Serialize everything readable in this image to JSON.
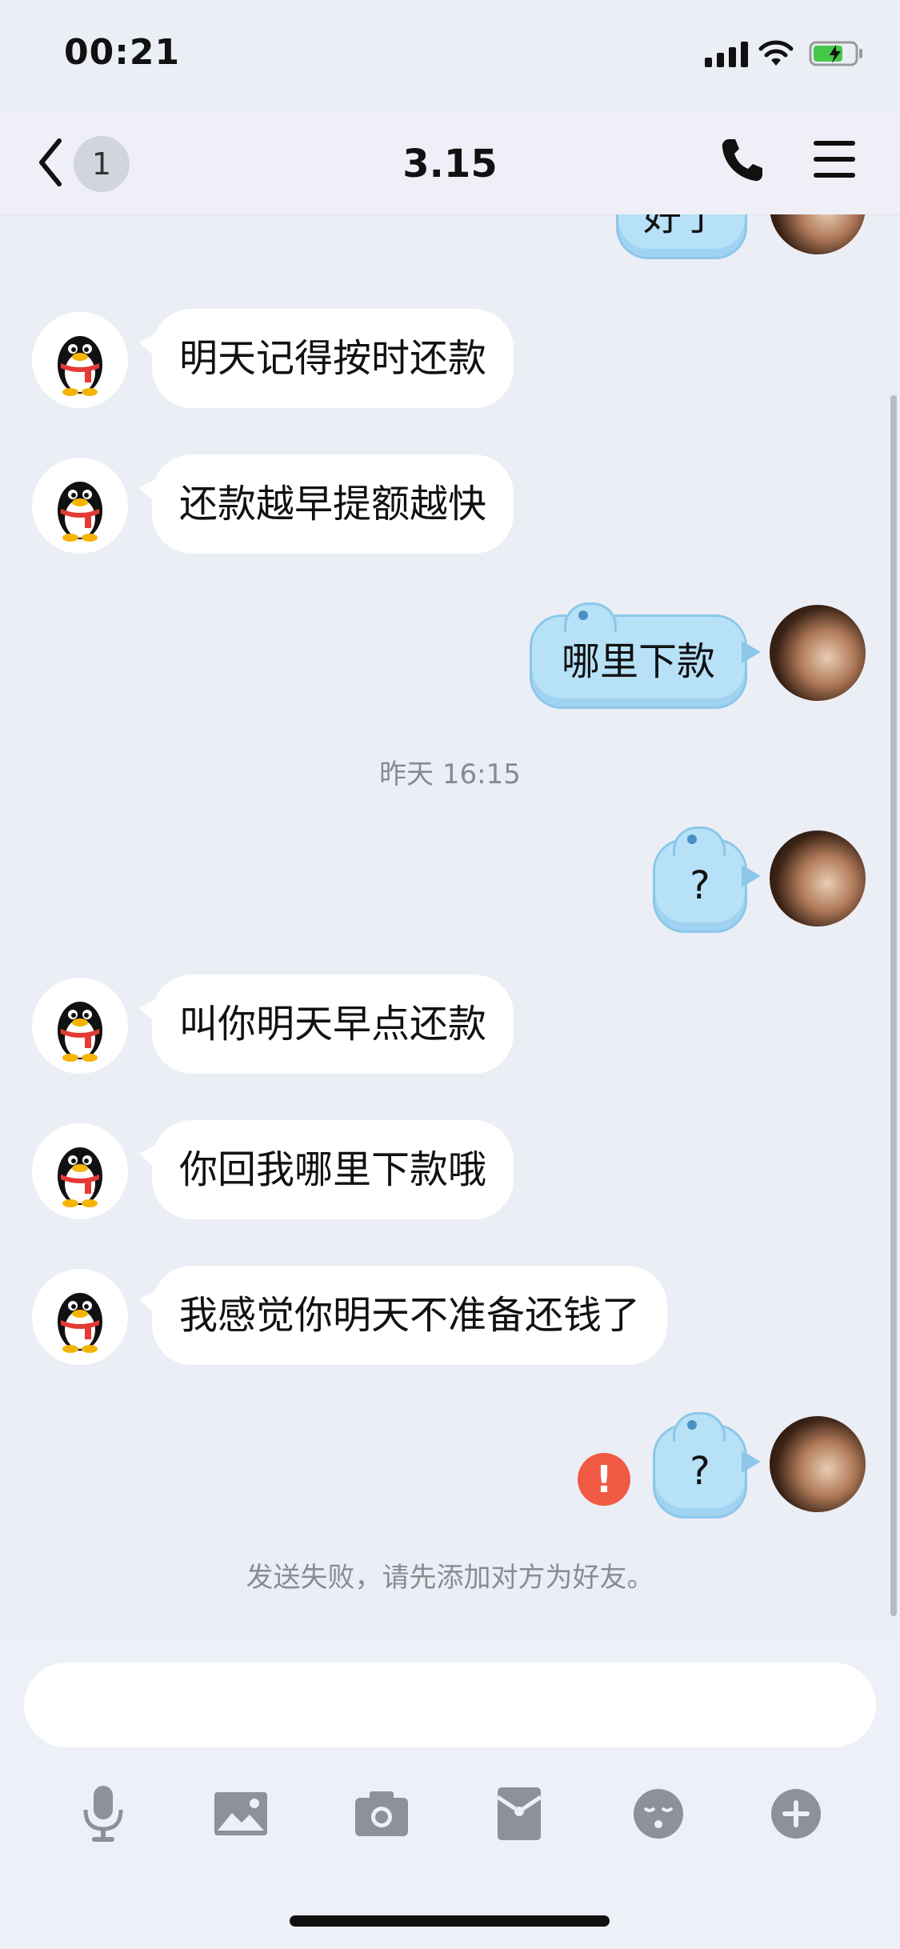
{
  "status_bar": {
    "time": "00:21"
  },
  "header": {
    "back_count": "1",
    "title": "3.15"
  },
  "messages": {
    "partial_out": "好了",
    "m1": "明天记得按时还款",
    "m2": "还款越早提额越快",
    "m3": "哪里下款",
    "timestamp": "昨天 16:15",
    "m4": "?",
    "m5": "叫你明天早点还款",
    "m6": "你回我哪里下款哦",
    "m7": "我感觉你明天不准备还钱了",
    "m8": "?",
    "error_mark": "!",
    "fail_note": "发送失败，请先添加对方为好友。"
  },
  "input": {
    "placeholder": ""
  },
  "toolbar_icons": [
    "microphone-icon",
    "image-icon",
    "camera-icon",
    "red-packet-icon",
    "emoji-icon",
    "plus-icon"
  ],
  "colors": {
    "outgoing_bubble": "#b7e1f7",
    "incoming_bubble": "#ffffff",
    "error": "#f05a45",
    "background": "#eceef6"
  }
}
